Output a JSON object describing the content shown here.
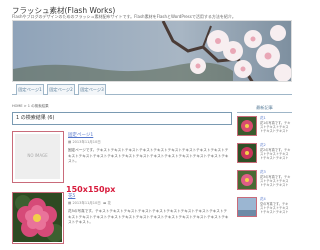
{
  "site": {
    "title": "フラッシュ素材(Flash Works)",
    "description": "Flashやブログのデザインのためのフラッシュ素材配布サイトです。Flash素材をFlashとWordPressで活用する方法を紹介。"
  },
  "nav": {
    "tabs": [
      {
        "label": "固定ページ1"
      },
      {
        "label": "固定ページ2"
      },
      {
        "label": "固定ページ3"
      }
    ]
  },
  "breadcrumb": "HOME > 1 の検索結果",
  "page_heading": "1 の検索結果 (6)",
  "posts": [
    {
      "title": "固定ページ1",
      "meta": "2013年11月10日",
      "excerpt": "固定ページです。テキストテキストテキストテキストテキストテキストテキストテキストテキストテキストテキストテキストテキストテキストテキストテキストテキストテキストテキストテキストテキスト。",
      "thumb_label": "NO IMAGE"
    },
    {
      "title": "花5",
      "meta": "2013年11月10日",
      "category": "花",
      "excerpt": "花5の写真です。テキストテキストテキストテキストテキストテキストテキストテキストテキストテキストテキストテキストテキストテキストテキストテキストテキストテキストテキストテキストテキストテキスト。",
      "thumb_size_label": "150x150px"
    }
  ],
  "sidebar": {
    "heading": "最新記事",
    "items": [
      {
        "title": "花1",
        "text": "花1の写真です。テキストテキストテキストテキストテキスト"
      },
      {
        "title": "花2",
        "text": "花2の写真です。テキストテキストテキストテキストテキスト"
      },
      {
        "title": "花3",
        "text": "花3の写真です。テキストテキストテキストテキストテキスト"
      },
      {
        "title": "花4",
        "text": "空の写真です。テキストテキストテキストテキストテキスト"
      }
    ]
  },
  "colors": {
    "accent_blue": "#5a7e9a",
    "link": "#5577cc",
    "thumb_border": "#c96b7a",
    "size_label": "#d81b3c"
  }
}
